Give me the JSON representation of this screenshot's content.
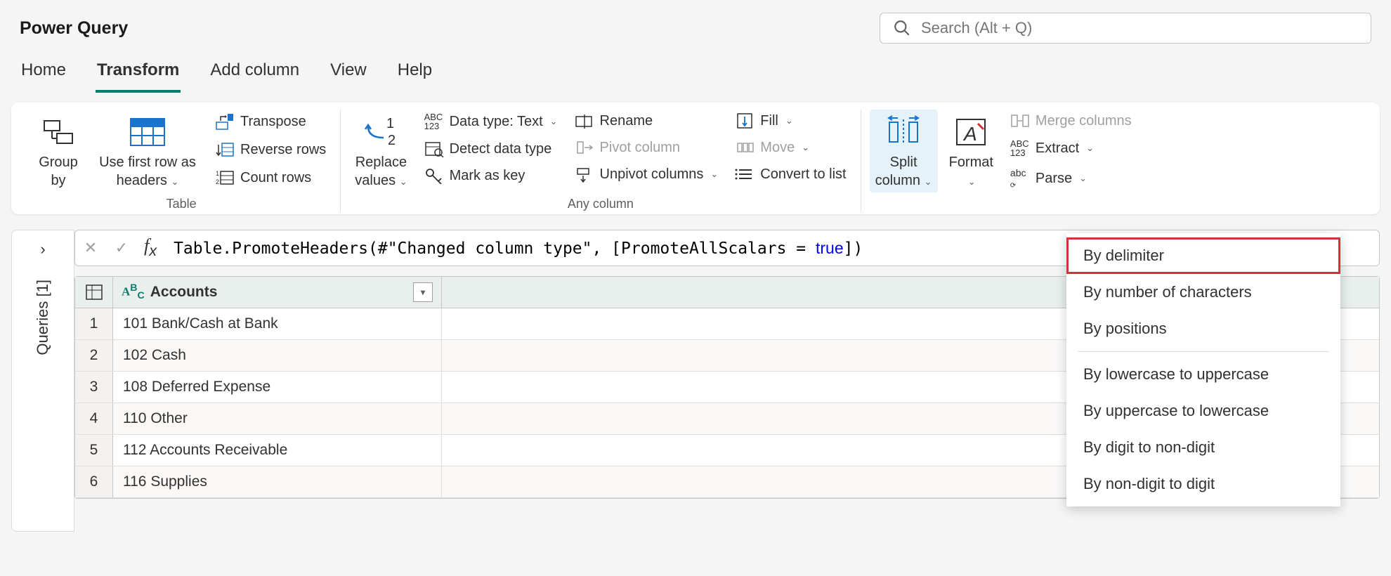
{
  "app_title": "Power Query",
  "search": {
    "placeholder": "Search (Alt + Q)"
  },
  "tabs": [
    "Home",
    "Transform",
    "Add column",
    "View",
    "Help"
  ],
  "active_tab": "Transform",
  "ribbon": {
    "table_group": {
      "label": "Table",
      "group_by": "Group\nby",
      "use_first_row": "Use first row as\nheaders",
      "transpose": "Transpose",
      "reverse_rows": "Reverse rows",
      "count_rows": "Count rows"
    },
    "any_column_group": {
      "label": "Any column",
      "replace_values": "Replace\nvalues",
      "data_type": "Data type: Text",
      "detect_data_type": "Detect data type",
      "mark_as_key": "Mark as key",
      "rename": "Rename",
      "pivot_column": "Pivot column",
      "unpivot_columns": "Unpivot columns",
      "fill": "Fill",
      "move": "Move",
      "convert_to_list": "Convert to list"
    },
    "text_group": {
      "split_column": "Split\ncolumn",
      "format": "Format",
      "merge_columns": "Merge columns",
      "extract": "Extract",
      "parse": "Parse"
    }
  },
  "split_menu": {
    "by_delimiter": "By delimiter",
    "by_number_chars": "By number of characters",
    "by_positions": "By positions",
    "by_lower_upper": "By lowercase to uppercase",
    "by_upper_lower": "By uppercase to lowercase",
    "by_digit_nondigit": "By digit to non-digit",
    "by_nondigit_digit": "By non-digit to digit"
  },
  "queries_panel": {
    "label": "Queries [1]"
  },
  "formula": "Table.PromoteHeaders(#\"Changed column type\", [PromoteAllScalars = true])",
  "grid": {
    "header_type_prefix": "ABC",
    "column": "Accounts",
    "rows": [
      "101 Bank/Cash at Bank",
      "102 Cash",
      "108 Deferred Expense",
      "110 Other",
      "112 Accounts Receivable",
      "116 Supplies"
    ]
  }
}
